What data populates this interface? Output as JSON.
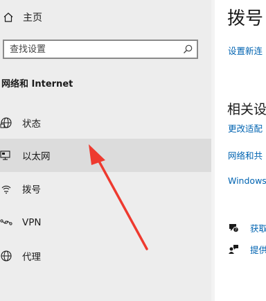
{
  "nav": {
    "home_label": "主页",
    "search_placeholder": "查找设置",
    "section_title": "网络和 Internet",
    "items": [
      {
        "label": "状态",
        "icon": "globe-status-icon"
      },
      {
        "label": "以太网",
        "icon": "ethernet-icon",
        "selected": true
      },
      {
        "label": "拨号",
        "icon": "dialup-icon"
      },
      {
        "label": "VPN",
        "icon": "vpn-icon"
      },
      {
        "label": "代理",
        "icon": "proxy-globe-icon"
      }
    ]
  },
  "content": {
    "page_title": "拨号",
    "setup_link": "设置新连",
    "related_title": "相关设",
    "related_links": [
      "更改适配",
      "网络和共",
      "Windows"
    ],
    "help": [
      {
        "label": "获取",
        "icon": "help-chat-icon"
      },
      {
        "label": "提供",
        "icon": "feedback-person-icon"
      }
    ]
  },
  "colors": {
    "nav_bg": "#ededed",
    "selected_bg": "#dcdcdc",
    "link": "#0063b1",
    "annotation_arrow": "#ee3a2f"
  }
}
